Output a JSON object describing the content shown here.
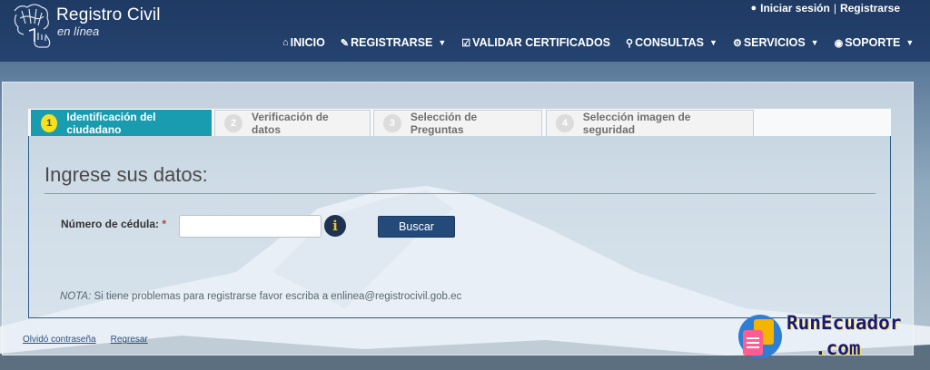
{
  "header": {
    "logo_title": "Registro Civil",
    "logo_subtitle": "en línea",
    "login_label": "Iniciar sesión",
    "separator": "|",
    "register_label": "Registrarse",
    "nav": [
      {
        "label": "INICIO",
        "icon": "home-icon",
        "dropdown": false
      },
      {
        "label": "REGISTRARSE",
        "icon": "pencil-icon",
        "dropdown": true
      },
      {
        "label": "VALIDAR CERTIFICADOS",
        "icon": "checkbox-icon",
        "dropdown": false
      },
      {
        "label": "CONSULTAS",
        "icon": "search-icon",
        "dropdown": true
      },
      {
        "label": "SERVICIOS",
        "icon": "gears-icon",
        "dropdown": true
      },
      {
        "label": "SOPORTE",
        "icon": "lifebuoy-icon",
        "dropdown": true
      }
    ]
  },
  "tabs": [
    {
      "num": "1",
      "label": "Identificación del ciudadano",
      "active": true
    },
    {
      "num": "2",
      "label": "Verificación de datos",
      "active": false
    },
    {
      "num": "3",
      "label": "Selección de Preguntas",
      "active": false
    },
    {
      "num": "4",
      "label": "Selección imagen de seguridad",
      "active": false
    }
  ],
  "form": {
    "heading": "Ingrese sus datos:",
    "cedula_label": "Número de cédula:",
    "required_mark": "*",
    "cedula_value": "",
    "info_glyph": "i",
    "search_button": "Buscar",
    "note_label": "NOTA:",
    "note_text": " Si tiene problemas para registrarse favor escriba a enlinea@registrocivil.gob.ec"
  },
  "footer": {
    "forgot_password": "Olvidó contraseña",
    "back": "Regresar"
  },
  "watermark": {
    "line1": "RunEcuador",
    "line2": ".com"
  },
  "colors": {
    "header_bg": "#1f3a63",
    "active_tab": "#1a9cb0",
    "active_tab_badge": "#f7e11c",
    "button_bg": "#244a7a"
  }
}
